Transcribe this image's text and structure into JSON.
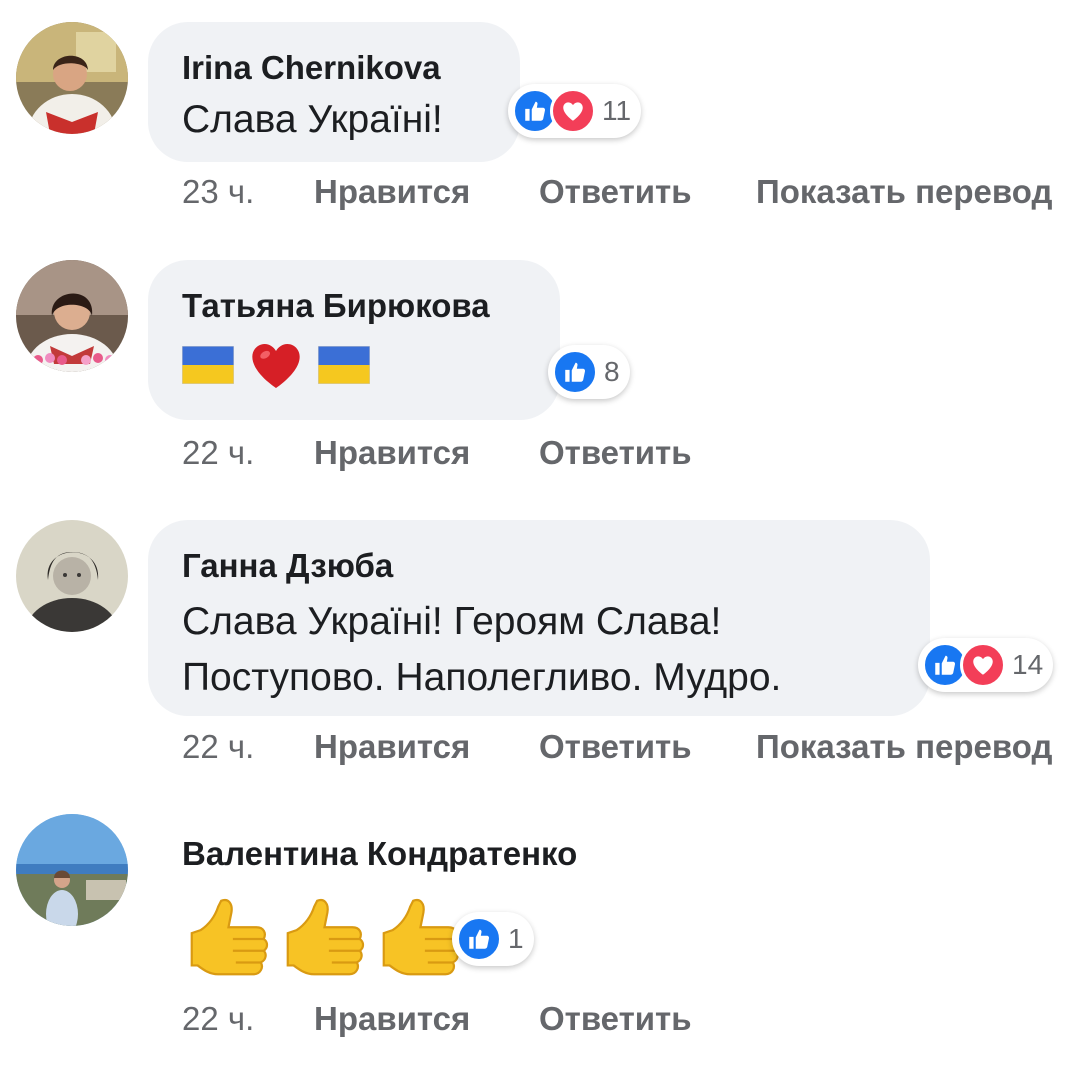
{
  "comments": [
    {
      "author": "Irina Chernikova",
      "text": "Слава Україні!",
      "reaction_count": "11",
      "reactions": [
        "like-icon",
        "love-icon"
      ],
      "time": "23 ч.",
      "like_label": "Нравится",
      "reply_label": "Ответить",
      "translate_label": "Показать перевод"
    },
    {
      "author": "Татьяна Бирюкова",
      "emoji": [
        "ukraine-flag",
        "red-heart",
        "ukraine-flag"
      ],
      "reaction_count": "8",
      "reactions": [
        "like-icon"
      ],
      "time": "22 ч.",
      "like_label": "Нравится",
      "reply_label": "Ответить"
    },
    {
      "author": "Ганна Дзюба",
      "text_lines": [
        "Слава Україні! Героям Слава!",
        "Поступово. Наполегливо. Мудро."
      ],
      "reaction_count": "14",
      "reactions": [
        "like-icon",
        "love-icon"
      ],
      "time": "22 ч.",
      "like_label": "Нравится",
      "reply_label": "Ответить",
      "translate_label": "Показать перевод"
    },
    {
      "author": "Валентина Кондратенко",
      "emoji": [
        "thumbs-up",
        "thumbs-up",
        "thumbs-up"
      ],
      "reaction_count": "1",
      "reactions": [
        "like-icon"
      ],
      "time": "22 ч.",
      "like_label": "Нравится",
      "reply_label": "Ответить"
    }
  ],
  "colors": {
    "bubble": "#f0f2f5",
    "like": "#1877f2",
    "love": "#f33e58",
    "meta_text": "#65676b",
    "author_text": "#1c1e21"
  }
}
